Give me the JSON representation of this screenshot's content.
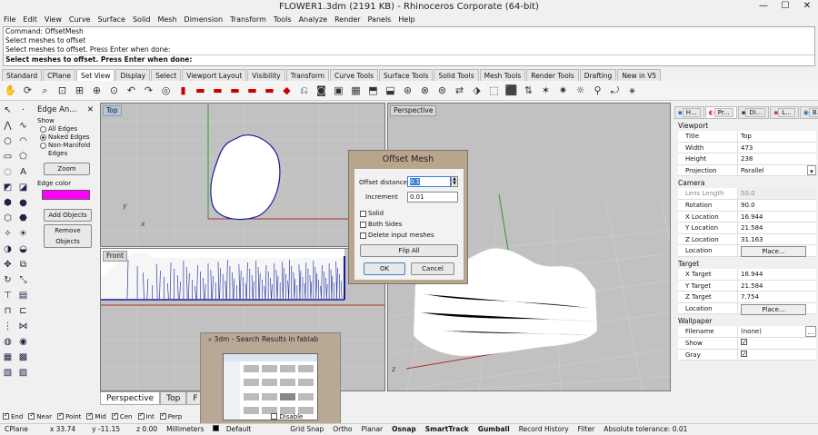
{
  "window": {
    "title": "FLOWER1.3dm (2191 KB) - Rhinoceros Corporate (64-bit)",
    "min": "—",
    "max": "☐",
    "close": "✕"
  },
  "menu": [
    "File",
    "Edit",
    "View",
    "Curve",
    "Surface",
    "Solid",
    "Mesh",
    "Dimension",
    "Transform",
    "Tools",
    "Analyze",
    "Render",
    "Panels",
    "Help"
  ],
  "command": {
    "lines": [
      "Command: OffsetMesh",
      "Select meshes to offset",
      "Select meshes to offset. Press Enter when done:"
    ],
    "prompt": "Select meshes to offset. Press Enter when done:"
  },
  "toolbar_tabs": [
    "Standard",
    "CPlane",
    "Set View",
    "Display",
    "Select",
    "Viewport Layout",
    "Visibility",
    "Transform",
    "Curve Tools",
    "Surface Tools",
    "Solid Tools",
    "Mesh Tools",
    "Render Tools",
    "Drafting",
    "New in V5"
  ],
  "toolbar_tabs_active": "Set View",
  "edge_panel": {
    "title": "Edge An...",
    "close": "✕",
    "show_label": "Show",
    "options": [
      "All Edges",
      "Naked Edges",
      "Non-Manifold Edges"
    ],
    "selected": "Naked Edges",
    "zoom_label": "Zoom",
    "edge_color_label": "Edge color",
    "edge_color": "#ff00ff",
    "add_objects": "Add Objects",
    "remove_objects": "Remove Objects"
  },
  "viewports": {
    "top": "Top",
    "front": "Front",
    "perspective": "Perspective",
    "axis_x": "x",
    "axis_y": "y",
    "axis_z": "z"
  },
  "viewport_tabs": [
    "Perspective",
    "Top",
    "F"
  ],
  "viewport_tabs_active": "Perspective",
  "dialog": {
    "title": "Offset Mesh",
    "offset_distance_label": "Offset distance",
    "offset_distance": "0.1",
    "increment_label": "Increment",
    "increment": "0.01",
    "solid": "Solid",
    "both_sides": "Both Sides",
    "delete_input": "Delete input meshes",
    "flip_all": "Flip All",
    "ok": "OK",
    "cancel": "Cancel"
  },
  "task_popup": {
    "title": "3dm - Search Results in fablab"
  },
  "osnap": {
    "items": [
      {
        "label": "End",
        "on": true
      },
      {
        "label": "Near",
        "on": true
      },
      {
        "label": "Point",
        "on": true
      },
      {
        "label": "Mid",
        "on": true
      },
      {
        "label": "Cen",
        "on": true
      },
      {
        "label": "Int",
        "on": true
      },
      {
        "label": "Perp",
        "on": true
      }
    ],
    "disable": "Disable"
  },
  "status": {
    "cplane": "CPlane",
    "x": "x 33.74",
    "y": "y -11.15",
    "z": "z 0.00",
    "units": "Millimeters",
    "layer": "Default",
    "items": [
      "Grid Snap",
      "Ortho",
      "Planar",
      "Osnap",
      "SmartTrack",
      "Gumball",
      "Record History",
      "Filter"
    ],
    "bold_items": [
      "Osnap",
      "SmartTrack",
      "Gumball"
    ],
    "tolerance": "Absolute tolerance: 0.01"
  },
  "right_panel": {
    "tabs": [
      "H...",
      "Pr...",
      "Di...",
      "L...",
      "B..."
    ],
    "active_tab": "Pr...",
    "viewport_section": "Viewport",
    "viewport": [
      {
        "k": "Title",
        "v": "Top"
      },
      {
        "k": "Width",
        "v": "473"
      },
      {
        "k": "Height",
        "v": "238"
      },
      {
        "k": "Projection",
        "v": "Parallel"
      }
    ],
    "camera_section": "Camera",
    "camera": [
      {
        "k": "Lens Length",
        "v": "50.0"
      },
      {
        "k": "Rotation",
        "v": "90.0"
      },
      {
        "k": "X Location",
        "v": "16.944"
      },
      {
        "k": "Y Location",
        "v": "21.584"
      },
      {
        "k": "Z Location",
        "v": "31.163"
      },
      {
        "k": "Location",
        "v": "Place..."
      }
    ],
    "target_section": "Target",
    "target": [
      {
        "k": "X Target",
        "v": "16.944"
      },
      {
        "k": "Y Target",
        "v": "21.584"
      },
      {
        "k": "Z Target",
        "v": "7.754"
      },
      {
        "k": "Location",
        "v": "Place..."
      }
    ],
    "wallpaper_section": "Wallpaper",
    "wallpaper": [
      {
        "k": "Filename",
        "v": "(none)"
      },
      {
        "k": "Show",
        "v": ""
      },
      {
        "k": "Gray",
        "v": ""
      }
    ]
  }
}
